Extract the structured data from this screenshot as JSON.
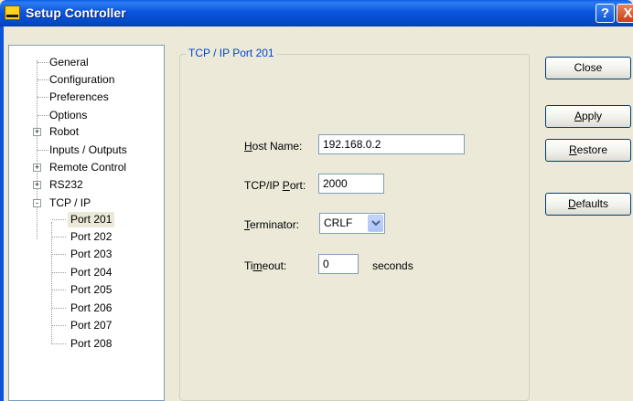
{
  "window": {
    "title": "Setup Controller",
    "help_glyph": "?",
    "close_glyph": "X"
  },
  "tree": {
    "items": [
      {
        "label": "General"
      },
      {
        "label": "Configuration"
      },
      {
        "label": "Preferences"
      },
      {
        "label": "Options"
      },
      {
        "label": "Robot",
        "expander": "+"
      },
      {
        "label": "Inputs / Outputs"
      },
      {
        "label": "Remote Control",
        "expander": "+"
      },
      {
        "label": "RS232",
        "expander": "+"
      },
      {
        "label": "TCP / IP",
        "expander": "-"
      },
      {
        "label": "Port 201",
        "selected": true
      },
      {
        "label": "Port 202"
      },
      {
        "label": "Port 203"
      },
      {
        "label": "Port 204"
      },
      {
        "label": "Port 205"
      },
      {
        "label": "Port 206"
      },
      {
        "label": "Port 207"
      },
      {
        "label": "Port 208"
      }
    ]
  },
  "group": {
    "title": "TCP / IP Port 201",
    "host_name": {
      "label_u": "H",
      "label_rest": "ost Name:",
      "value": "192.168.0.2"
    },
    "port": {
      "label_pre": "TCP/IP ",
      "label_u": "P",
      "label_rest": "ort:",
      "value": "2000"
    },
    "terminator": {
      "label_u": "T",
      "label_rest": "erminator:",
      "value": "CRLF"
    },
    "timeout": {
      "label_pre": "Ti",
      "label_u": "m",
      "label_rest": "eout:",
      "value": "0",
      "unit": "seconds"
    }
  },
  "buttons": {
    "close": "Close",
    "apply_u": "A",
    "apply_rest": "pply",
    "restore_u": "R",
    "restore_rest": "estore",
    "defaults_u": "D",
    "defaults_rest": "efaults"
  }
}
